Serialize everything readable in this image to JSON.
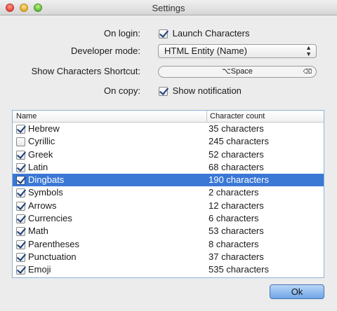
{
  "window": {
    "title": "Settings"
  },
  "form": {
    "on_login": {
      "label": "On login:",
      "checkbox_label": "Launch Characters",
      "checked": true
    },
    "developer_mode": {
      "label": "Developer mode:",
      "value": "HTML Entity (Name)"
    },
    "shortcut": {
      "label": "Show Characters Shortcut:",
      "value": "⌥Space",
      "clear_glyph": "⌫"
    },
    "on_copy": {
      "label": "On copy:",
      "checkbox_label": "Show notification",
      "checked": true
    }
  },
  "table": {
    "headers": {
      "name": "Name",
      "count": "Character count"
    },
    "rows": [
      {
        "name": "Hebrew",
        "count": "35 characters",
        "checked": true,
        "selected": false
      },
      {
        "name": "Cyrillic",
        "count": "245 characters",
        "checked": false,
        "selected": false
      },
      {
        "name": "Greek",
        "count": "52 characters",
        "checked": true,
        "selected": false
      },
      {
        "name": "Latin",
        "count": "68 characters",
        "checked": true,
        "selected": false
      },
      {
        "name": "Dingbats",
        "count": "190 characters",
        "checked": true,
        "selected": true
      },
      {
        "name": "Symbols",
        "count": "2 characters",
        "checked": true,
        "selected": false
      },
      {
        "name": "Arrows",
        "count": "12 characters",
        "checked": true,
        "selected": false
      },
      {
        "name": "Currencies",
        "count": "6 characters",
        "checked": true,
        "selected": false
      },
      {
        "name": "Math",
        "count": "53 characters",
        "checked": true,
        "selected": false
      },
      {
        "name": "Parentheses",
        "count": "8 characters",
        "checked": true,
        "selected": false
      },
      {
        "name": "Punctuation",
        "count": "37 characters",
        "checked": true,
        "selected": false
      },
      {
        "name": "Emoji",
        "count": "535 characters",
        "checked": true,
        "selected": false
      }
    ]
  },
  "buttons": {
    "ok": "Ok"
  },
  "colors": {
    "selection": "#3b78d6",
    "table_border": "#8eb2dc",
    "ok_button": "#6ea5e6"
  }
}
